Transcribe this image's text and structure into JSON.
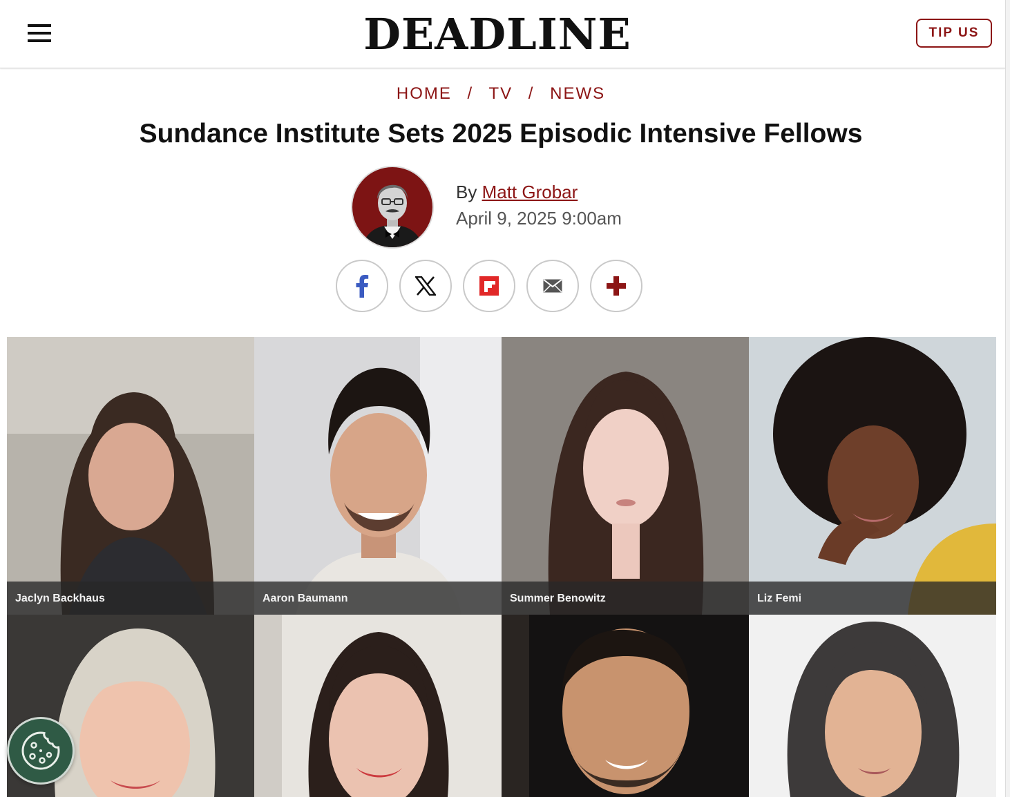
{
  "header": {
    "logo": "DEADLINE",
    "tip_button": "TIP US"
  },
  "breadcrumb": {
    "items": [
      "HOME",
      "TV",
      "NEWS"
    ],
    "separator": "/"
  },
  "article": {
    "title": "Sundance Institute Sets 2025 Episodic Intensive Fellows",
    "byline_prefix": "By",
    "author": "Matt Grobar",
    "date": "April 9, 2025 9:00am"
  },
  "share": {
    "buttons": [
      "facebook-icon",
      "x-icon",
      "flipboard-icon",
      "email-icon",
      "plus-icon"
    ]
  },
  "photos": {
    "row1": [
      {
        "name": "Jaclyn Backhaus"
      },
      {
        "name": "Aaron Baumann"
      },
      {
        "name": "Summer Benowitz"
      },
      {
        "name": "Liz Femi"
      }
    ]
  },
  "colors": {
    "accent": "#8c1515",
    "cookie_button": "#2f5a45"
  },
  "cookie_button": {
    "icon": "cookie-icon"
  }
}
